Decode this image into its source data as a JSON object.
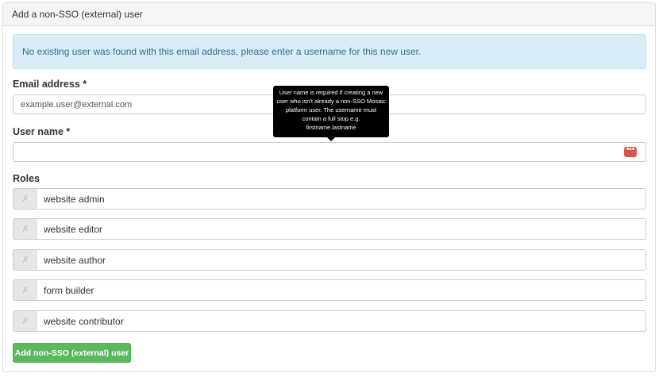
{
  "panel": {
    "title": "Add a non-SSO (external) user"
  },
  "alert": {
    "text": "No existing user was found with this email address, please enter a username for this new user."
  },
  "email": {
    "label": "Email address *",
    "value": "example.user@external.com"
  },
  "username": {
    "label": "User name *",
    "value": "",
    "tooltip": "User name is required if creating a new user who isn't already a non-SSO Mosaic platform user. The username must contain a full stop e.g. firstname.lastname",
    "error_icon_glyph": "•••"
  },
  "roles": {
    "label": "Roles",
    "toggle_glyph": "✗",
    "items": [
      {
        "label": "website admin",
        "checked": false
      },
      {
        "label": "website editor",
        "checked": false
      },
      {
        "label": "website author",
        "checked": false
      },
      {
        "label": "form builder",
        "checked": false
      },
      {
        "label": "website contributor",
        "checked": false
      }
    ]
  },
  "submit": {
    "label": "Add non-SSO (external) user"
  },
  "colors": {
    "submit_bg": "#5cb85c",
    "alert_bg": "#d9edf7",
    "error": "#d9534f"
  }
}
